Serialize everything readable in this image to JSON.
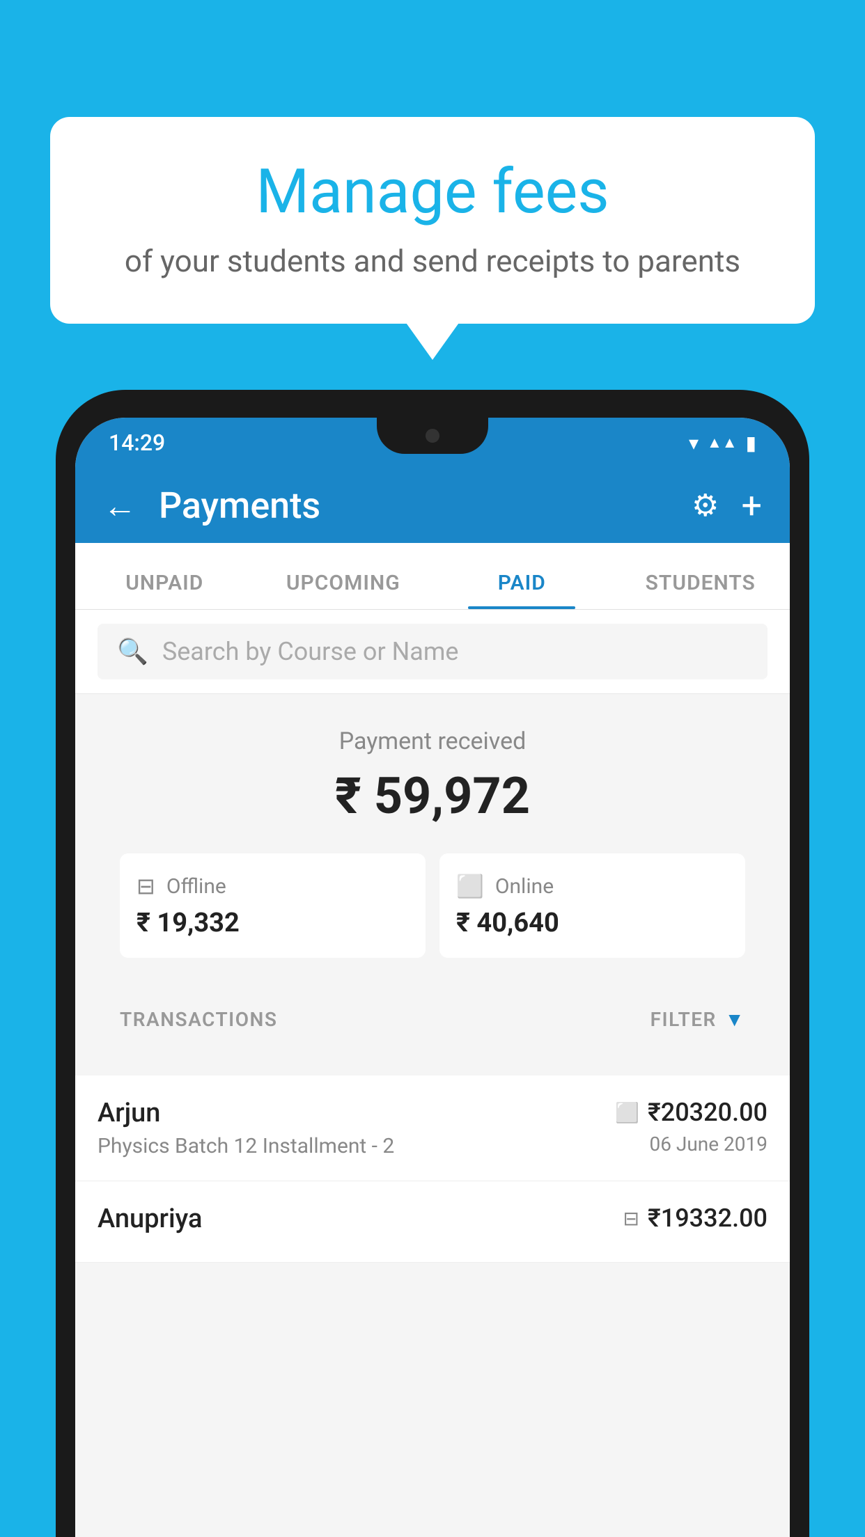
{
  "background": "#1ab3e8",
  "bubble": {
    "title": "Manage fees",
    "subtitle": "of your students and send receipts to parents"
  },
  "status_bar": {
    "time": "14:29",
    "wifi_icon": "▼",
    "signal_icon": "▲",
    "battery_icon": "▮"
  },
  "app_bar": {
    "title": "Payments",
    "back_icon": "←",
    "settings_icon": "⚙",
    "add_icon": "+"
  },
  "tabs": [
    {
      "label": "UNPAID",
      "active": false
    },
    {
      "label": "UPCOMING",
      "active": false
    },
    {
      "label": "PAID",
      "active": true
    },
    {
      "label": "STUDENTS",
      "active": false
    }
  ],
  "search": {
    "placeholder": "Search by Course or Name"
  },
  "payment": {
    "label": "Payment received",
    "amount": "₹ 59,972",
    "offline": {
      "label": "Offline",
      "amount": "₹ 19,332"
    },
    "online": {
      "label": "Online",
      "amount": "₹ 40,640"
    }
  },
  "transactions": {
    "header_label": "TRANSACTIONS",
    "filter_label": "FILTER",
    "items": [
      {
        "name": "Arjun",
        "course": "Physics Batch 12 Installment - 2",
        "amount": "₹20320.00",
        "date": "06 June 2019",
        "pay_type": "online"
      },
      {
        "name": "Anupriya",
        "course": "",
        "amount": "₹19332.00",
        "date": "",
        "pay_type": "offline"
      }
    ]
  }
}
